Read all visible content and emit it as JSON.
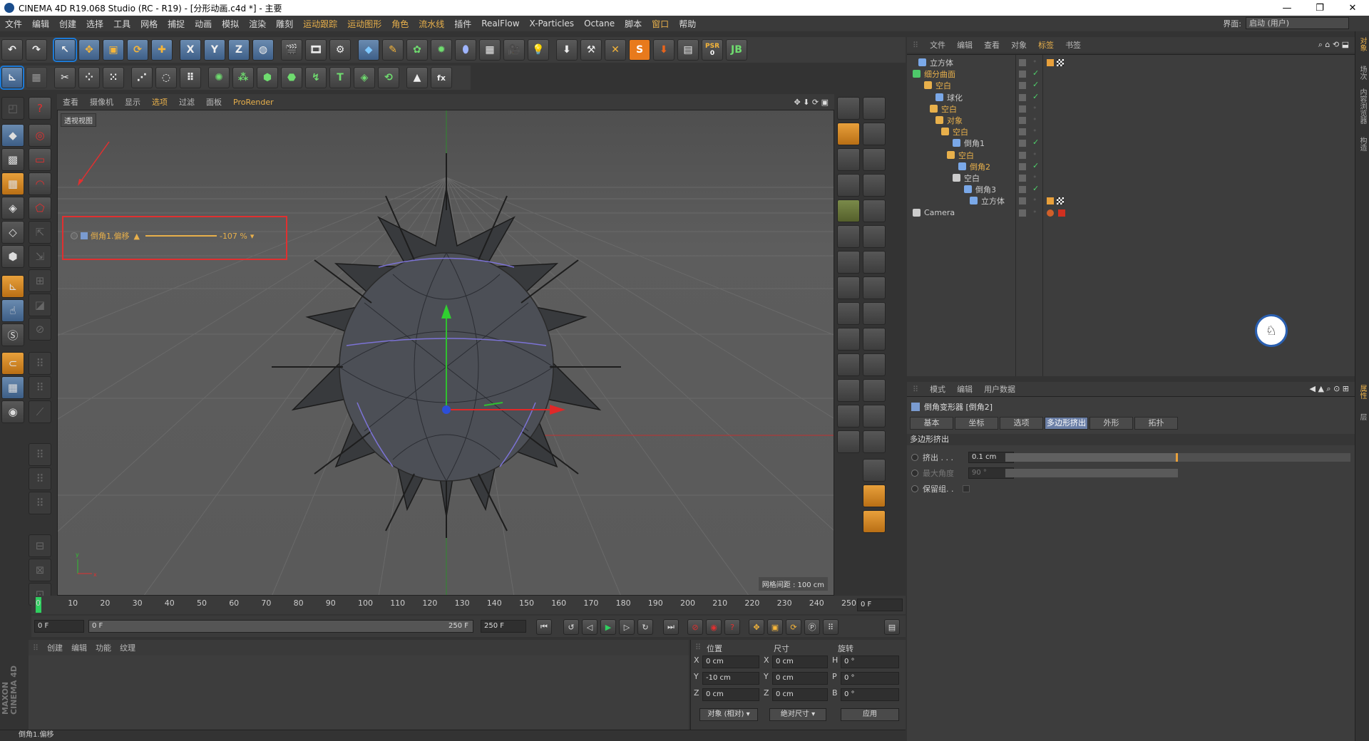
{
  "window": {
    "title": "CINEMA 4D R19.068 Studio (RC - R19) - [分形动画.c4d *] - 主要",
    "controls": [
      "—",
      "❐",
      "✕"
    ]
  },
  "menubar": [
    "文件",
    "编辑",
    "创建",
    "选择",
    "工具",
    "网格",
    "捕捉",
    "动画",
    "模拟",
    "渲染",
    "雕刻",
    "运动跟踪",
    "运动图形",
    "角色",
    "流水线",
    "插件",
    "RealFlow",
    "X-Particles",
    "Octane",
    "脚本",
    "窗口",
    "帮助"
  ],
  "layout": {
    "label": "界面:",
    "value": "启动 (用户)"
  },
  "toolbar_top": {
    "axis_labels": [
      "X",
      "Y",
      "Z"
    ],
    "psr_label": "PSR",
    "psr_value": "0"
  },
  "viewport": {
    "menu": [
      "查看",
      "摄像机",
      "显示",
      "选项",
      "过滤",
      "面板",
      "ProRender"
    ],
    "label": "透视视图",
    "grid_note": "网格间距 : 100 cm",
    "axis_y": "y",
    "axis_x": "x"
  },
  "hud": {
    "label": "倒角1.偏移",
    "value": "-107 %"
  },
  "object_manager": {
    "menu": [
      "文件",
      "编辑",
      "查看",
      "对象",
      "标签",
      "书签"
    ],
    "objects": [
      {
        "name": "立方体",
        "color": "#cccccc"
      },
      {
        "name": "细分曲面",
        "color": "#e8b04b"
      },
      {
        "name": "空白",
        "color": "#e8b04b"
      },
      {
        "name": "球化",
        "color": "#cccccc"
      },
      {
        "name": "空白",
        "color": "#e8b04b"
      },
      {
        "name": "对象",
        "color": "#e8b04b"
      },
      {
        "name": "空白",
        "color": "#e8b04b"
      },
      {
        "name": "倒角1",
        "color": "#cccccc"
      },
      {
        "name": "空白",
        "color": "#e8b04b"
      },
      {
        "name": "倒角2",
        "color": "#e8b04b"
      },
      {
        "name": "空白",
        "color": "#cccccc"
      },
      {
        "name": "倒角3",
        "color": "#cccccc"
      },
      {
        "name": "立方体",
        "color": "#cccccc"
      },
      {
        "name": "Camera",
        "color": "#cccccc"
      }
    ]
  },
  "attribute_manager": {
    "menu": [
      "模式",
      "编辑",
      "用户数据"
    ],
    "title": "倒角变形器 [倒角2]",
    "tabs": [
      "基本",
      "坐标",
      "选项",
      "多边形挤出",
      "外形",
      "拓扑"
    ],
    "active_tab": "多边形挤出",
    "section": "多边形挤出",
    "rows": [
      {
        "label": "挤出 . . .",
        "value": "0.1 cm"
      },
      {
        "label": "最大角度",
        "value": "90 °"
      },
      {
        "label": "保留组. .",
        "value": ""
      }
    ]
  },
  "right_sidebar": [
    "对象",
    "场次",
    "内容浏览器",
    "构造",
    "属性",
    "层"
  ],
  "timeline": {
    "ticks": [
      "0",
      "10",
      "20",
      "30",
      "40",
      "50",
      "60",
      "70",
      "80",
      "90",
      "100",
      "110",
      "120",
      "130",
      "140",
      "150",
      "160",
      "170",
      "180",
      "190",
      "200",
      "210",
      "220",
      "230",
      "240",
      "250"
    ],
    "current_frame": "0 F",
    "start": "0 F",
    "range_start": "0 F",
    "range_end": "250 F",
    "end": "250 F"
  },
  "material_manager": {
    "menu": [
      "创建",
      "编辑",
      "功能",
      "纹理"
    ],
    "brand_line1": "MAXON",
    "brand_line2": "CINEMA 4D"
  },
  "coordinates": {
    "headers": [
      "位置",
      "尺寸",
      "旋转"
    ],
    "rows": [
      {
        "axis": "X",
        "pos": "0 cm",
        "size_axis": "X",
        "size": "0 cm",
        "rot_axis": "H",
        "rot": "0 °"
      },
      {
        "axis": "Y",
        "pos": "-10 cm",
        "size_axis": "Y",
        "size": "0 cm",
        "rot_axis": "P",
        "rot": "0 °"
      },
      {
        "axis": "Z",
        "pos": "0 cm",
        "size_axis": "Z",
        "size": "0 cm",
        "rot_axis": "B",
        "rot": "0 °"
      }
    ],
    "mode_object": "对象 (相对)",
    "mode_size": "绝对尺寸",
    "apply": "应用"
  },
  "status": "倒角1.偏移",
  "colors": {
    "accent": "#e8b04b",
    "selected_tab": "#6b7fa6",
    "highlight_red": "#e03030"
  }
}
